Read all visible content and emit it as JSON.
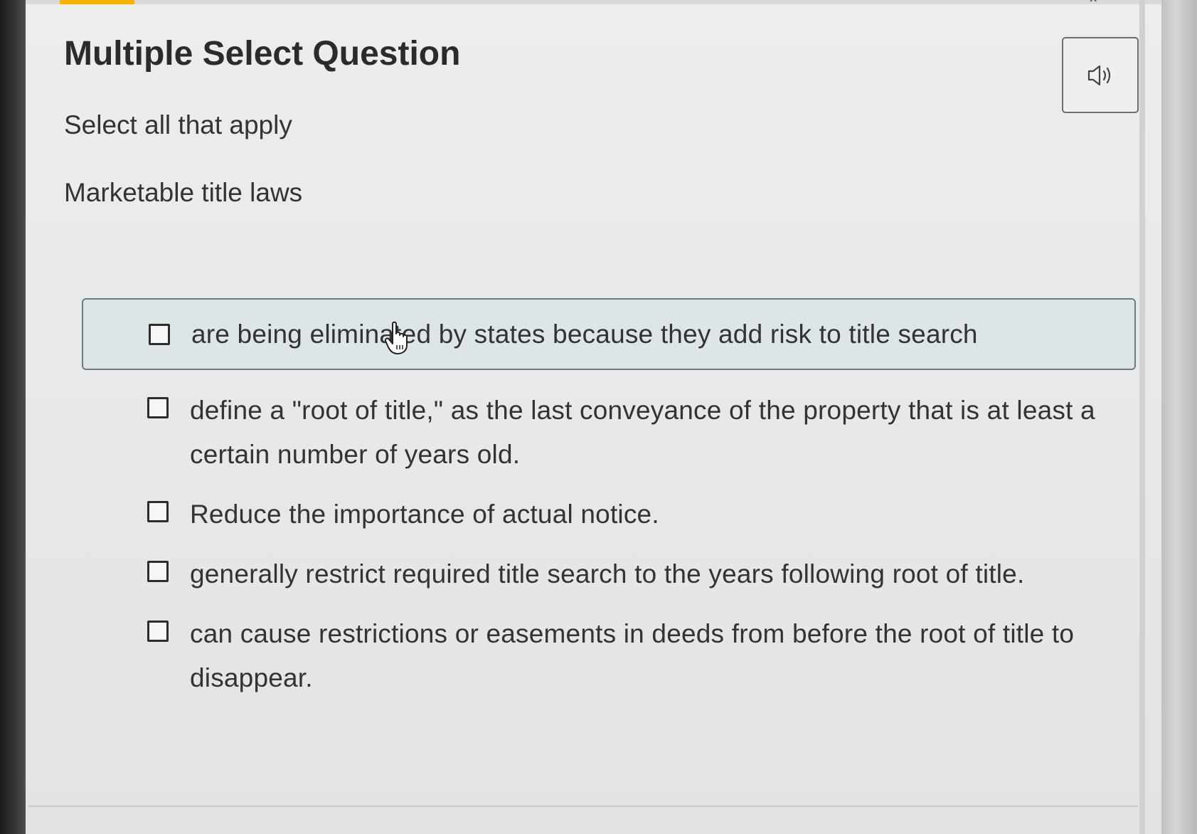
{
  "question": {
    "title": "Multiple Select Question",
    "instructions": "Select all that apply",
    "prompt": "Marketable title laws"
  },
  "audio": {
    "icon": "speaker-icon"
  },
  "options": [
    {
      "label": "are being eliminated by states because they add risk to title search",
      "checked": false,
      "highlighted": true
    },
    {
      "label": "define a \"root of title,\" as the last conveyance of the property that is at least a certain number of years old.",
      "checked": false,
      "highlighted": false
    },
    {
      "label": "Reduce the importance of actual notice.",
      "checked": false,
      "highlighted": false
    },
    {
      "label": "generally restrict required title search to the years following root of title.",
      "checked": false,
      "highlighted": false
    },
    {
      "label": "can cause restrictions or easements in deeds from before the root of title to disappear.",
      "checked": false,
      "highlighted": false
    }
  ],
  "colors": {
    "accent": "#f4b400",
    "highlight_bg": "#dde5e8",
    "text": "#333333"
  }
}
